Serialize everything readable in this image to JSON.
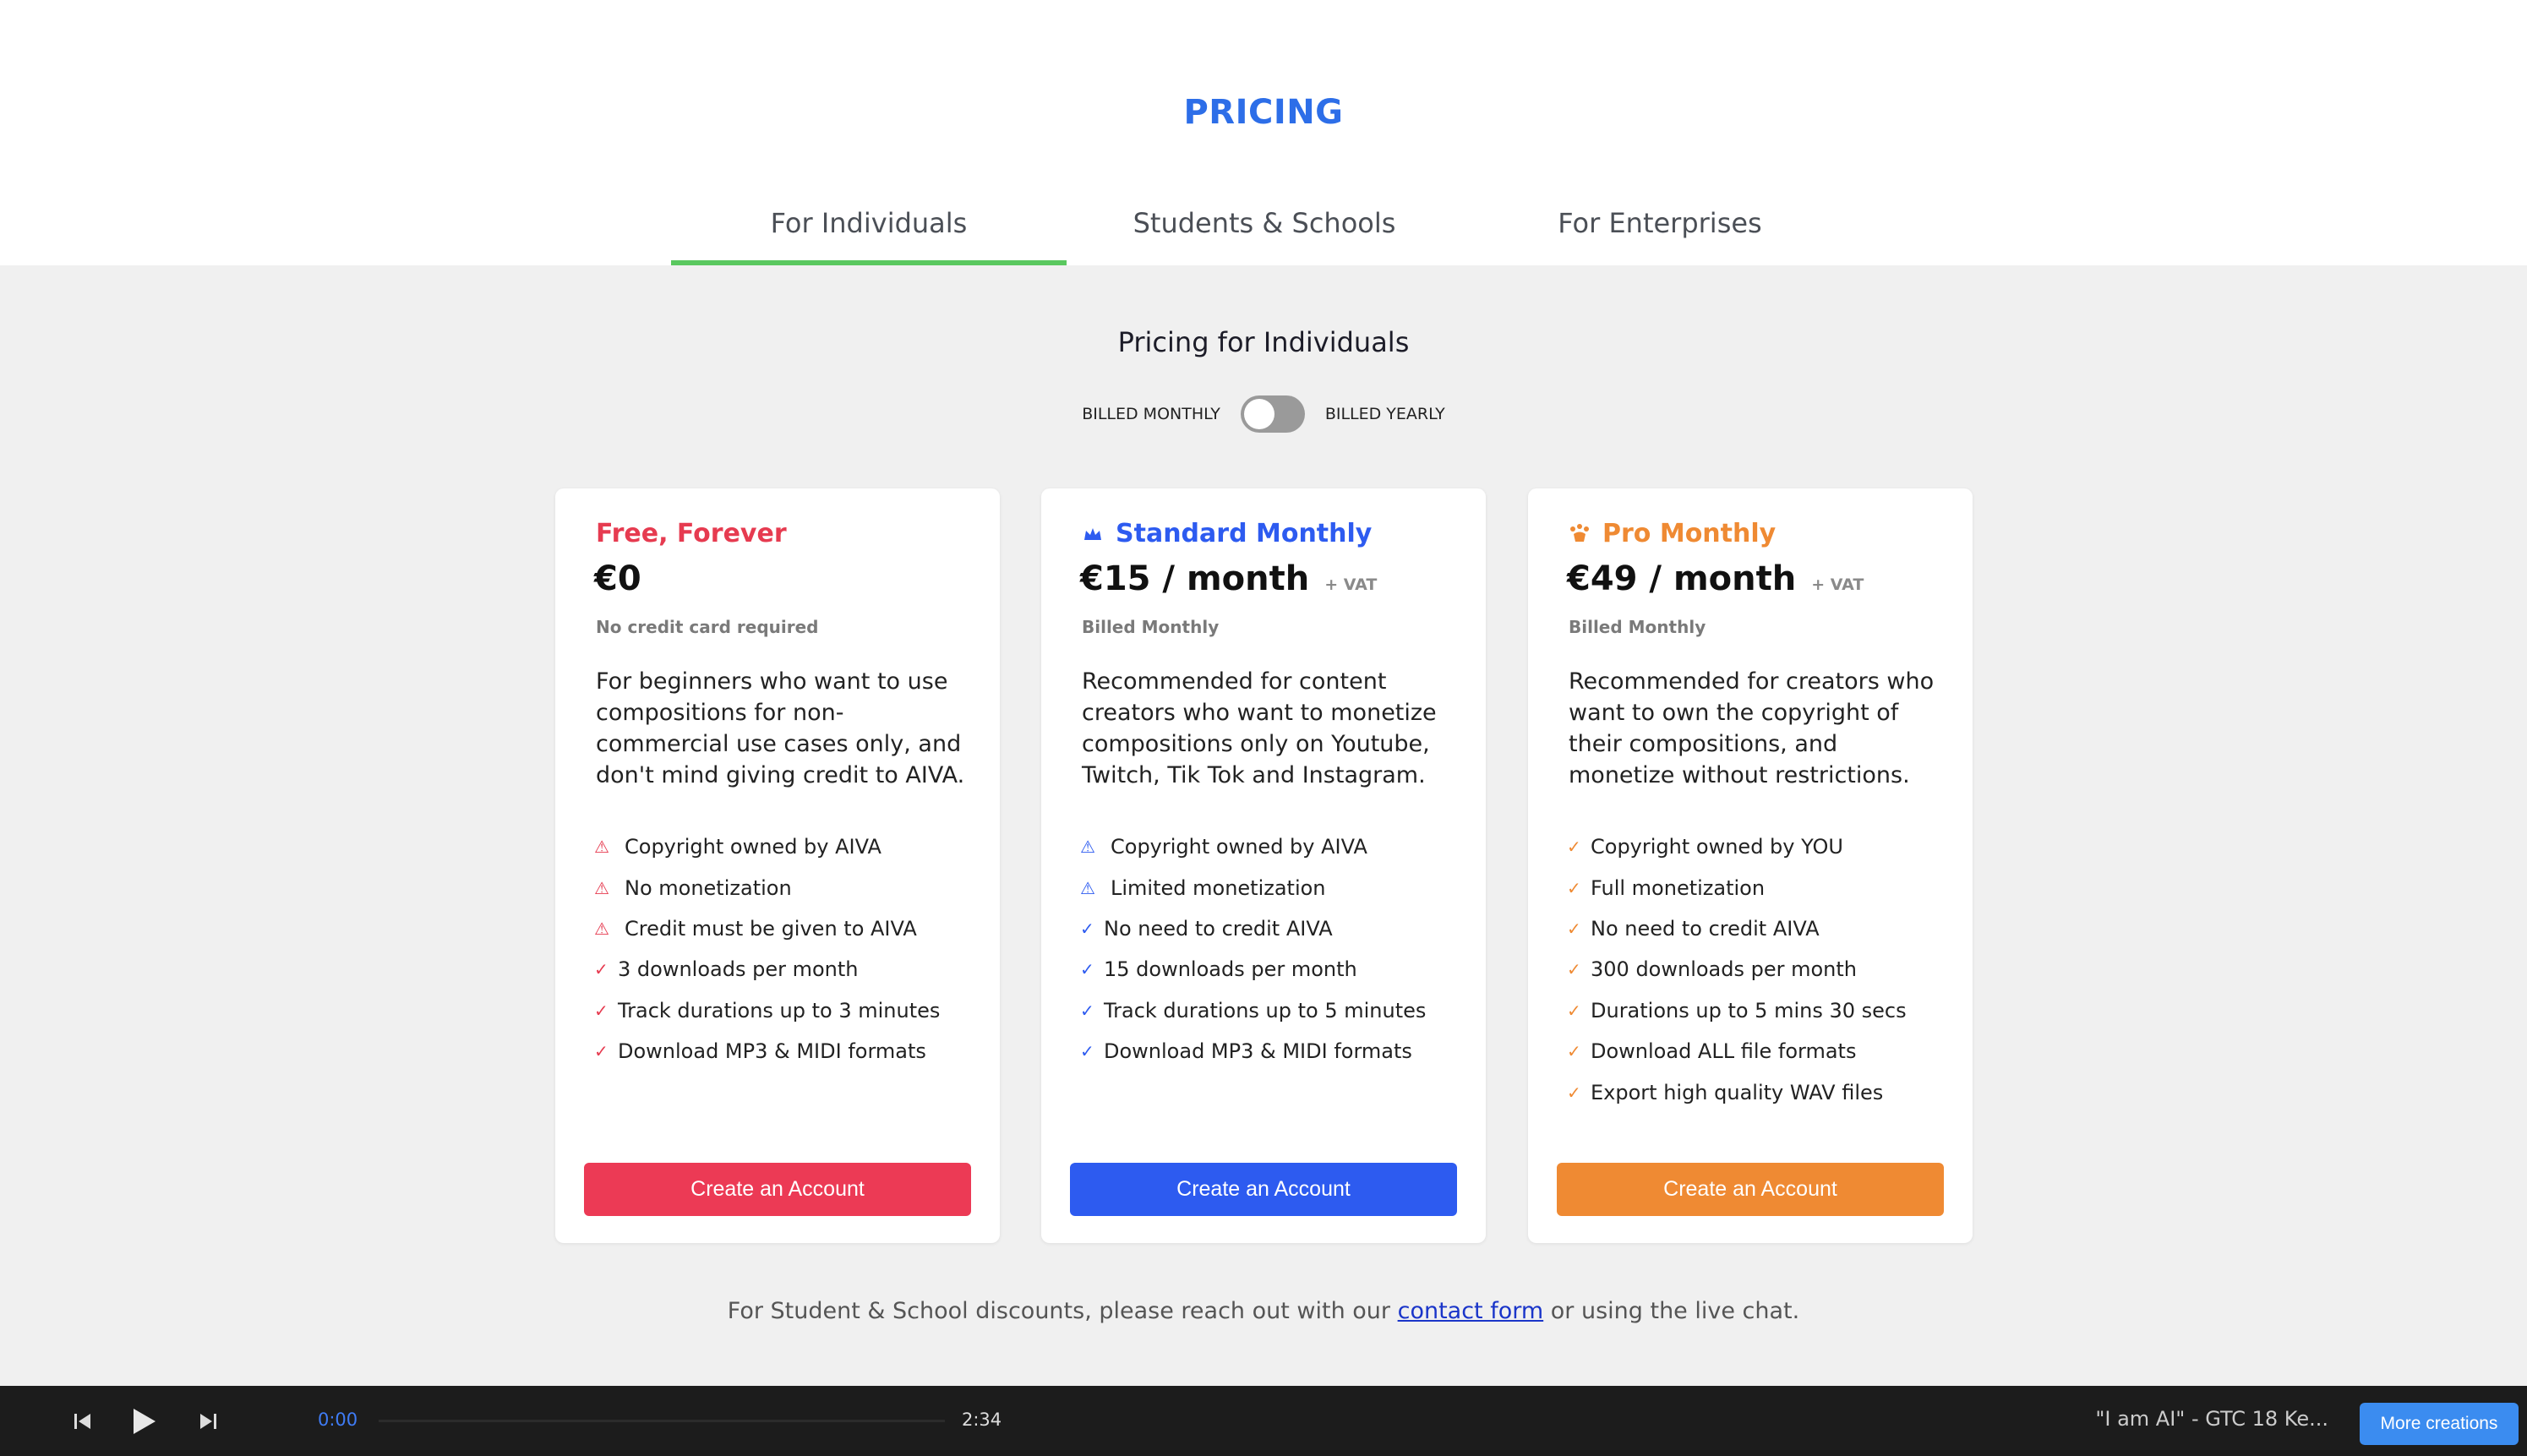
{
  "header": {
    "title": "PRICING",
    "tabs": [
      {
        "label": "For Individuals",
        "active": true
      },
      {
        "label": "Students & Schools",
        "active": false
      },
      {
        "label": "For Enterprises",
        "active": false
      }
    ]
  },
  "section": {
    "title": "Pricing for Individuals",
    "billing_left": "BILLED MONTHLY",
    "billing_right": "BILLED YEARLY",
    "billing_toggle": "off"
  },
  "plans": [
    {
      "name": "Free, Forever",
      "price": "€0",
      "vat": "",
      "billed": "No credit card required",
      "description": "For beginners who want to use compositions for non-commercial use cases only, and don't mind giving credit to AIVA.",
      "color": "#e63b50",
      "icon": "none",
      "features": [
        {
          "icon": "warning-icon",
          "text": "Copyright owned by AIVA"
        },
        {
          "icon": "warning-icon",
          "text": "No monetization"
        },
        {
          "icon": "warning-icon",
          "text": "Credit must be given to AIVA"
        },
        {
          "icon": "check-icon",
          "text": "3 downloads per month"
        },
        {
          "icon": "check-icon",
          "text": "Track durations up to 3 minutes"
        },
        {
          "icon": "check-icon",
          "text": "Download MP3 & MIDI formats"
        }
      ],
      "button": "Create an Account"
    },
    {
      "name": "Standard Monthly",
      "price": "€15 / month",
      "vat": "+ VAT",
      "billed": "Billed Monthly",
      "description": "Recommended for content creators who want to monetize compositions only on Youtube, Twitch, Tik Tok and Instagram.",
      "color": "#2d5bf0",
      "icon": "crown-icon",
      "features": [
        {
          "icon": "warning-icon",
          "text": "Copyright owned by AIVA"
        },
        {
          "icon": "warning-icon",
          "text": "Limited monetization"
        },
        {
          "icon": "check-icon",
          "text": "No need to credit AIVA"
        },
        {
          "icon": "check-icon",
          "text": "15 downloads per month"
        },
        {
          "icon": "check-icon",
          "text": "Track durations up to 5 minutes"
        },
        {
          "icon": "check-icon",
          "text": "Download MP3 & MIDI formats"
        }
      ],
      "button": "Create an Account"
    },
    {
      "name": "Pro Monthly",
      "price": "€49 / month",
      "vat": "+ VAT",
      "billed": "Billed Monthly",
      "description": "Recommended for creators who want to own the copyright of their compositions, and monetize without restrictions.",
      "color": "#ef8a33",
      "icon": "paw-crown-icon",
      "features": [
        {
          "icon": "check-icon",
          "text": "Copyright owned by YOU"
        },
        {
          "icon": "check-icon",
          "text": "Full monetization"
        },
        {
          "icon": "check-icon",
          "text": "No need to credit AIVA"
        },
        {
          "icon": "check-icon",
          "text": "300 downloads per month"
        },
        {
          "icon": "check-icon",
          "text": "Durations up to 5 mins 30 secs"
        },
        {
          "icon": "check-icon",
          "text": "Download ALL file formats"
        },
        {
          "icon": "check-icon",
          "text": "Export high quality WAV files"
        }
      ],
      "button": "Create an Account"
    }
  ],
  "footer": {
    "note_before": "For Student & School discounts, please reach out with our ",
    "link": "contact form",
    "note_after": " or using the live chat."
  },
  "player": {
    "current_time": "0:00",
    "total_time": "2:34",
    "progress": 0,
    "now_playing": "\"I am AI\" - GTC 18 Ke...",
    "more_button": "More creations"
  }
}
